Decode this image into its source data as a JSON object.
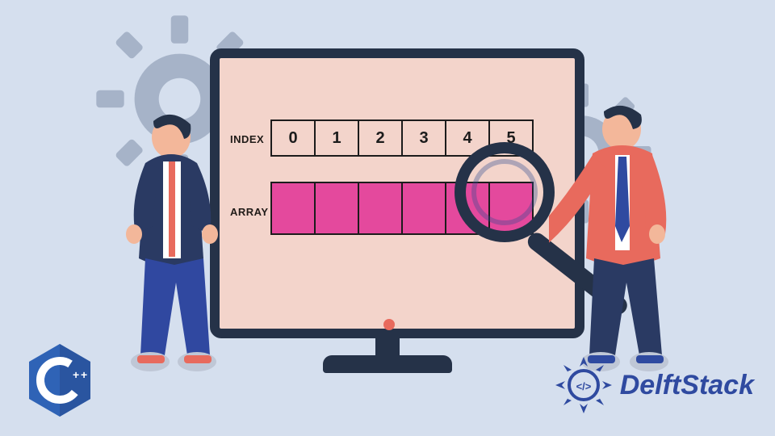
{
  "labels": {
    "index": "INDEX",
    "array": "ARRAY"
  },
  "index_cells": [
    "0",
    "1",
    "2",
    "3",
    "4",
    "5"
  ],
  "array_cell_count": 6,
  "brand": {
    "name": "DelftStack",
    "lang_badge": "C++"
  },
  "colors": {
    "bg": "#d5dfee",
    "gear": "#a6b3c8",
    "monitor_frame": "#253248",
    "screen": "#f3d4cb",
    "array_fill": "#e4499d",
    "accent_red": "#e86a5d",
    "navy": "#2a3a63",
    "cpp_blue": "#2f63b6",
    "delft_blue": "#2f4aa0"
  }
}
